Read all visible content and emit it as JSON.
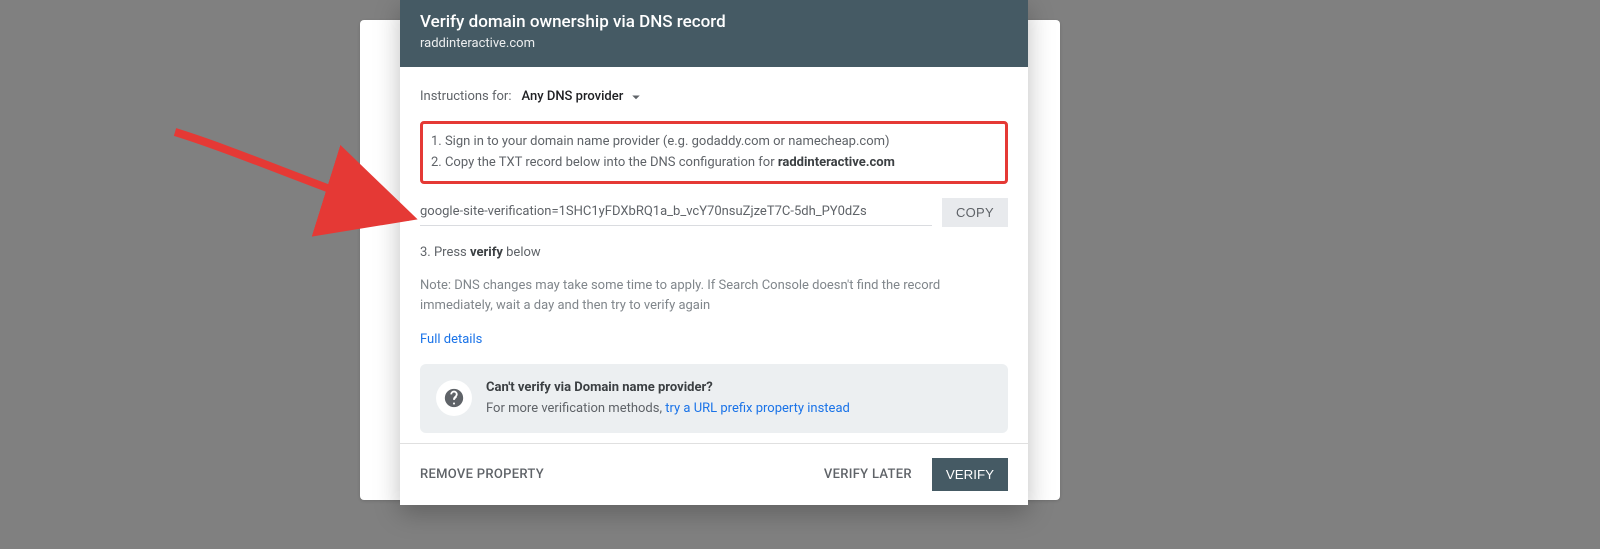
{
  "header": {
    "title": "Verify domain ownership via DNS record",
    "subtitle": "raddinteractive.com"
  },
  "instructions": {
    "label": "Instructions for:",
    "provider": "Any DNS provider",
    "step1": "1. Sign in to your domain name provider (e.g. godaddy.com or namecheap.com)",
    "step2_prefix": "2. Copy the TXT record below into the DNS configuration for ",
    "step2_domain": "raddinteractive.com"
  },
  "txt": {
    "value": "google-site-verification=1SHC1yFDXbRQ1a_b_vcY70nsuZjzeT7C-5dh_PY0dZs",
    "copy_label": "COPY"
  },
  "step3": {
    "prefix": "3. Press ",
    "bold": "verify",
    "suffix": " below"
  },
  "note": "Note: DNS changes may take some time to apply. If Search Console doesn't find the record immediately, wait a day and then try to verify again",
  "full_details": "Full details",
  "alt": {
    "question": "Can't verify via Domain name provider?",
    "answer_prefix": "For more verification methods, ",
    "answer_link": "try a URL prefix property instead"
  },
  "footer": {
    "remove": "REMOVE PROPERTY",
    "later": "VERIFY LATER",
    "verify": "VERIFY"
  }
}
